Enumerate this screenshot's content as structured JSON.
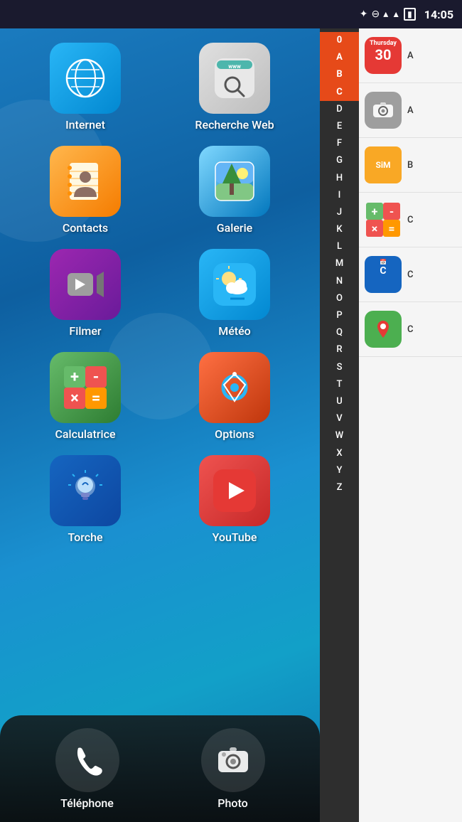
{
  "statusBar": {
    "time": "14:05",
    "icons": [
      "bluetooth",
      "dnd",
      "wifi",
      "signal",
      "battery"
    ]
  },
  "homescreen": {
    "apps": [
      {
        "id": "internet",
        "label": "Internet",
        "colorClass": "icon-internet",
        "icon": "🌐"
      },
      {
        "id": "recherche-web",
        "label": "Recherche Web",
        "colorClass": "icon-web",
        "icon": "🔍"
      },
      {
        "id": "contacts",
        "label": "Contacts",
        "colorClass": "icon-contacts",
        "icon": "👤"
      },
      {
        "id": "galerie",
        "label": "Galerie",
        "colorClass": "icon-galerie",
        "icon": "🖼"
      },
      {
        "id": "filmer",
        "label": "Filmer",
        "colorClass": "icon-filmer",
        "icon": "📹"
      },
      {
        "id": "meteo",
        "label": "Météo",
        "colorClass": "icon-meteo",
        "icon": "⛅"
      },
      {
        "id": "calculatrice",
        "label": "Calculatrice",
        "colorClass": "icon-calc",
        "icon": "🧮"
      },
      {
        "id": "options",
        "label": "Options",
        "colorClass": "icon-options",
        "icon": "⚙"
      },
      {
        "id": "torche",
        "label": "Torche",
        "colorClass": "icon-torche",
        "icon": "💡"
      },
      {
        "id": "youtube",
        "label": "YouTube",
        "colorClass": "icon-youtube",
        "icon": "▶"
      }
    ],
    "dock": [
      {
        "id": "telephone",
        "label": "Téléphone",
        "icon": "📞"
      },
      {
        "id": "photo",
        "label": "Photo",
        "icon": "📷"
      }
    ]
  },
  "alphabetSidebar": {
    "letters": [
      "0",
      "A",
      "B",
      "C",
      "D",
      "E",
      "F",
      "G",
      "H",
      "I",
      "J",
      "K",
      "L",
      "M",
      "N",
      "O",
      "P",
      "Q",
      "R",
      "S",
      "T",
      "U",
      "V",
      "W",
      "X",
      "Y",
      "Z"
    ],
    "activeIndex": 3
  },
  "rightPanel": {
    "apps": [
      {
        "id": "calendar",
        "label": "A",
        "icon": "📅",
        "bg": "#e53935"
      },
      {
        "id": "camera",
        "label": "A",
        "icon": "📷",
        "bg": "#757575"
      },
      {
        "id": "sim",
        "label": "B",
        "icon": "SIM",
        "bg": "#f9a825"
      },
      {
        "id": "calc2",
        "label": "C",
        "icon": "🧮",
        "bg": "#4caf50"
      },
      {
        "id": "cal2",
        "label": "C",
        "icon": "📆",
        "bg": "#1565c0"
      },
      {
        "id": "maps",
        "label": "C",
        "icon": "📍",
        "bg": "#4caf50"
      }
    ]
  }
}
